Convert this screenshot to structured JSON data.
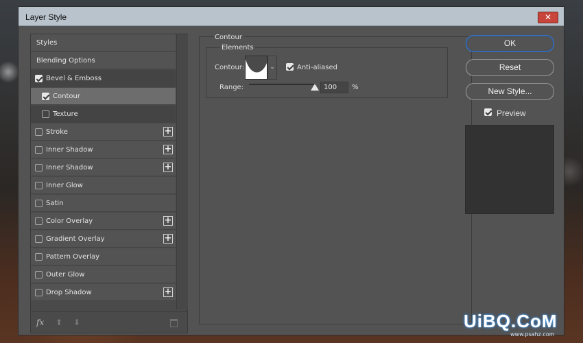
{
  "window": {
    "title": "Layer Style",
    "close_glyph": "✕"
  },
  "styles_list": {
    "rows": [
      {
        "label": "Styles"
      },
      {
        "label": "Blending Options"
      },
      {
        "label": "Bevel & Emboss"
      },
      {
        "label": "Contour"
      },
      {
        "label": "Texture"
      },
      {
        "label": "Stroke"
      },
      {
        "label": "Inner Shadow"
      },
      {
        "label": "Inner Shadow"
      },
      {
        "label": "Inner Glow"
      },
      {
        "label": "Satin"
      },
      {
        "label": "Color Overlay"
      },
      {
        "label": "Gradient Overlay"
      },
      {
        "label": "Pattern Overlay"
      },
      {
        "label": "Outer Glow"
      },
      {
        "label": "Drop Shadow"
      }
    ],
    "footer": {
      "fx_label": "fx",
      "up_glyph": "⬆",
      "down_glyph": "⬇"
    }
  },
  "contour_panel": {
    "group_title": "Contour",
    "subgroup_title": "Elements",
    "contour_label": "Contour:",
    "anti_aliased_label": "Anti-aliased",
    "anti_aliased_checked": true,
    "range_label": "Range:",
    "range_value": "100",
    "range_unit": "%",
    "dropdown_glyph": "⌄"
  },
  "actions": {
    "ok_label": "OK",
    "reset_label": "Reset",
    "new_style_label": "New Style...",
    "preview_label": "Preview",
    "preview_checked": true
  },
  "watermark": {
    "text": "UiBQ.CoM",
    "sub": "www.psahz.com"
  },
  "colors": {
    "accent": "#3c78c8",
    "close": "#c7453b",
    "panel": "#535353"
  }
}
